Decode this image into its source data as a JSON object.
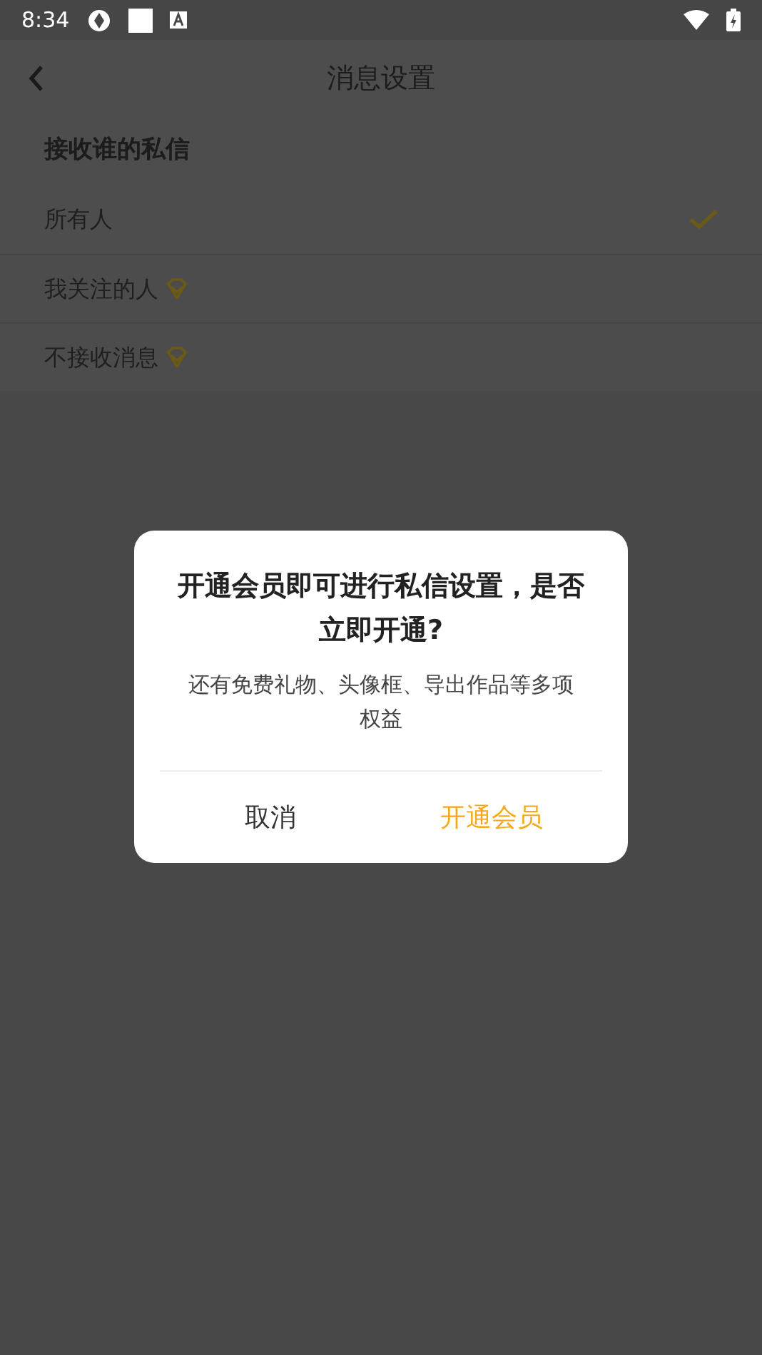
{
  "status_bar": {
    "time": "8:34"
  },
  "header": {
    "title": "消息设置"
  },
  "section": {
    "title": "接收谁的私信"
  },
  "options": [
    {
      "label": "所有人",
      "selected": true,
      "premium": false
    },
    {
      "label": "我关注的人",
      "selected": false,
      "premium": true
    },
    {
      "label": "不接收消息",
      "selected": false,
      "premium": true
    }
  ],
  "dialog": {
    "title": "开通会员即可进行私信设置，是否立即开通?",
    "message": "还有免费礼物、头像框、导出作品等多项权益",
    "buttons": [
      {
        "label": "取消",
        "kind": "cancel"
      },
      {
        "label": "开通会员",
        "kind": "primary"
      }
    ]
  }
}
